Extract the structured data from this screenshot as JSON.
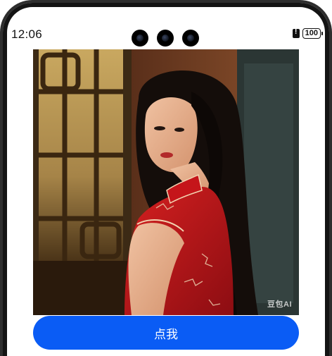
{
  "status_bar": {
    "time": "12:06",
    "battery": "100",
    "icons": [
      "front-camera-icon",
      "alert-icon",
      "battery-icon"
    ]
  },
  "image": {
    "description_icon": "photo",
    "watermark": "豆包AI"
  },
  "button": {
    "label": "点我",
    "color": "#0a5cf5"
  }
}
